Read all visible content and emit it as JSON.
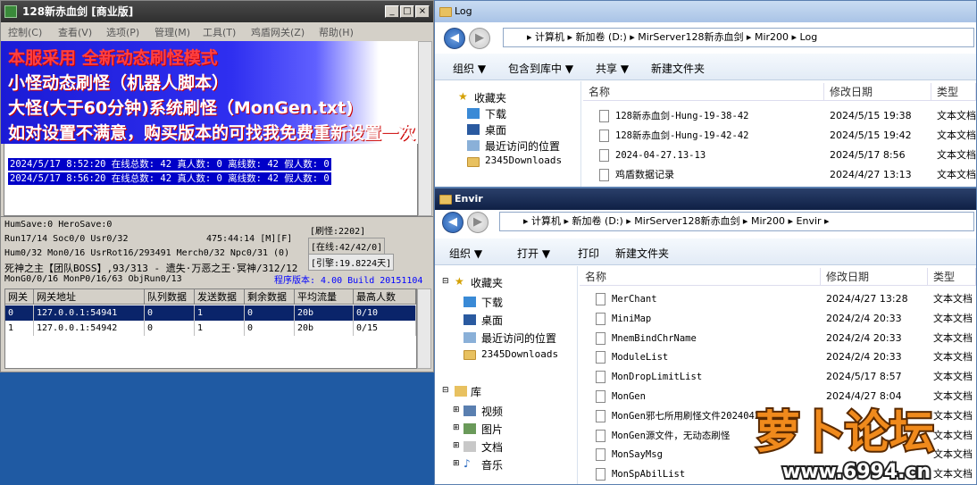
{
  "server": {
    "title": "128新赤血剑 [商业版]",
    "menu": [
      "控制(C)",
      "查看(V)",
      "选项(P)",
      "管理(M)",
      "工具(T)",
      "鸡盾网关(Z)",
      "帮助(H)"
    ],
    "ad_lines": [
      "本服采用 全新动态刷怪模式",
      "小怪动态刷怪（机器人脚本）",
      "大怪(大于60分钟)系统刷怪（MonGen.txt)",
      "如对设置不满意，购买版本的可找我免费重新设置一次"
    ],
    "log_lines": [
      "2024/5/17 8:52:20 在线总数: 42 真人数: 0 离线数: 42 假人数: 0",
      "2024/5/17 8:56:20 在线总数: 42 真人数: 0 离线数: 42 假人数: 0"
    ],
    "stats": {
      "line1": "HumSave:0 HeroSave:0",
      "refresh": "[刷怪:2202]",
      "line2": "Run17/14 Soc0/0 Usr0/32",
      "uptime": "475:44:14 [M][F]",
      "online": "[在线:42/42/0]",
      "line3": "Hum0/32 Mon0/16 UsrRot16/293491 Merch0/32 Npc0/31 (0)",
      "line4": "死神之主【团队BOSS】,93/313 - 遗失·万恶之王·冥神/312/12",
      "ingot": "[引擎:19.8224天]",
      "line5": "MonG0/0/16 MonP0/16/63 ObjRun0/13",
      "version": "程序版本: 4.00 Build 20151104"
    },
    "grid": {
      "headers": [
        "网关",
        "网关地址",
        "队列数据",
        "发送数据",
        "剩余数据",
        "平均流量",
        "最高人数"
      ],
      "rows": [
        [
          "0",
          "127.0.0.1:54941",
          "0",
          "1",
          "0",
          "20b",
          "0/10"
        ],
        [
          "1",
          "127.0.0.1:54942",
          "0",
          "1",
          "0",
          "20b",
          "0/15"
        ]
      ]
    }
  },
  "log_window": {
    "title": "Log",
    "address": "▸ 计算机 ▸ 新加卷 (D:) ▸ MirServer128新赤血剑 ▸ Mir200 ▸ Log",
    "toolbar": [
      "组织 ▼",
      "包含到库中 ▼",
      "共享 ▼",
      "新建文件夹"
    ],
    "nav": [
      "收藏夹",
      "下载",
      "桌面",
      "最近访问的位置",
      "2345Downloads"
    ],
    "columns": [
      "名称",
      "修改日期",
      "类型"
    ],
    "files": [
      {
        "name": "128新赤血剑-Hung-19-38-42",
        "date": "2024/5/15 19:38",
        "type": "文本文档"
      },
      {
        "name": "128新赤血剑-Hung-19-42-42",
        "date": "2024/5/15 19:42",
        "type": "文本文档"
      },
      {
        "name": "2024-04-27.13-13",
        "date": "2024/5/17 8:56",
        "type": "文本文档"
      },
      {
        "name": "鸡盾数据记录",
        "date": "2024/4/27 13:13",
        "type": "文本文档"
      }
    ]
  },
  "envir_window": {
    "title": "Envir",
    "address": "▸ 计算机 ▸ 新加卷 (D:) ▸ MirServer128新赤血剑 ▸ Mir200 ▸ Envir ▸",
    "toolbar": [
      "组织 ▼",
      "打开 ▼",
      "打印",
      "新建文件夹"
    ],
    "nav_fav": [
      "收藏夹",
      "下载",
      "桌面",
      "最近访问的位置",
      "2345Downloads"
    ],
    "nav_lib": [
      "库",
      "视频",
      "图片",
      "文档",
      "音乐"
    ],
    "columns": [
      "名称",
      "修改日期",
      "类型"
    ],
    "files": [
      {
        "name": "MerChant",
        "date": "2024/4/27 13:28",
        "type": "文本文档"
      },
      {
        "name": "MiniMap",
        "date": "2024/2/4 20:33",
        "type": "文本文档"
      },
      {
        "name": "MnemBindChrName",
        "date": "2024/2/4 20:33",
        "type": "文本文档"
      },
      {
        "name": "ModuleList",
        "date": "2024/2/4 20:33",
        "type": "文本文档"
      },
      {
        "name": "MonDropLimitList",
        "date": "2024/5/17 8:57",
        "type": "文本文档"
      },
      {
        "name": "MonGen",
        "date": "2024/4/27 8:04",
        "type": "文本文档"
      },
      {
        "name": "MonGen邪七所用刷怪文件20240427",
        "date": "",
        "type": "文本文档"
      },
      {
        "name": "MonGen源文件，无动态刷怪",
        "date": "",
        "type": "文本文档"
      },
      {
        "name": "MonSayMsg",
        "date": "",
        "type": "文本文档"
      },
      {
        "name": "MonSpAbilList",
        "date": "",
        "type": "文本文档"
      }
    ]
  },
  "watermark": {
    "brand": "萝卜论坛",
    "url": "www.6994.cn"
  },
  "colors": {
    "desktop": "#1f5aa3",
    "highlight": "#0000c8",
    "ad_text": "#ffffff",
    "watermark_orange": "#f08a1c"
  }
}
